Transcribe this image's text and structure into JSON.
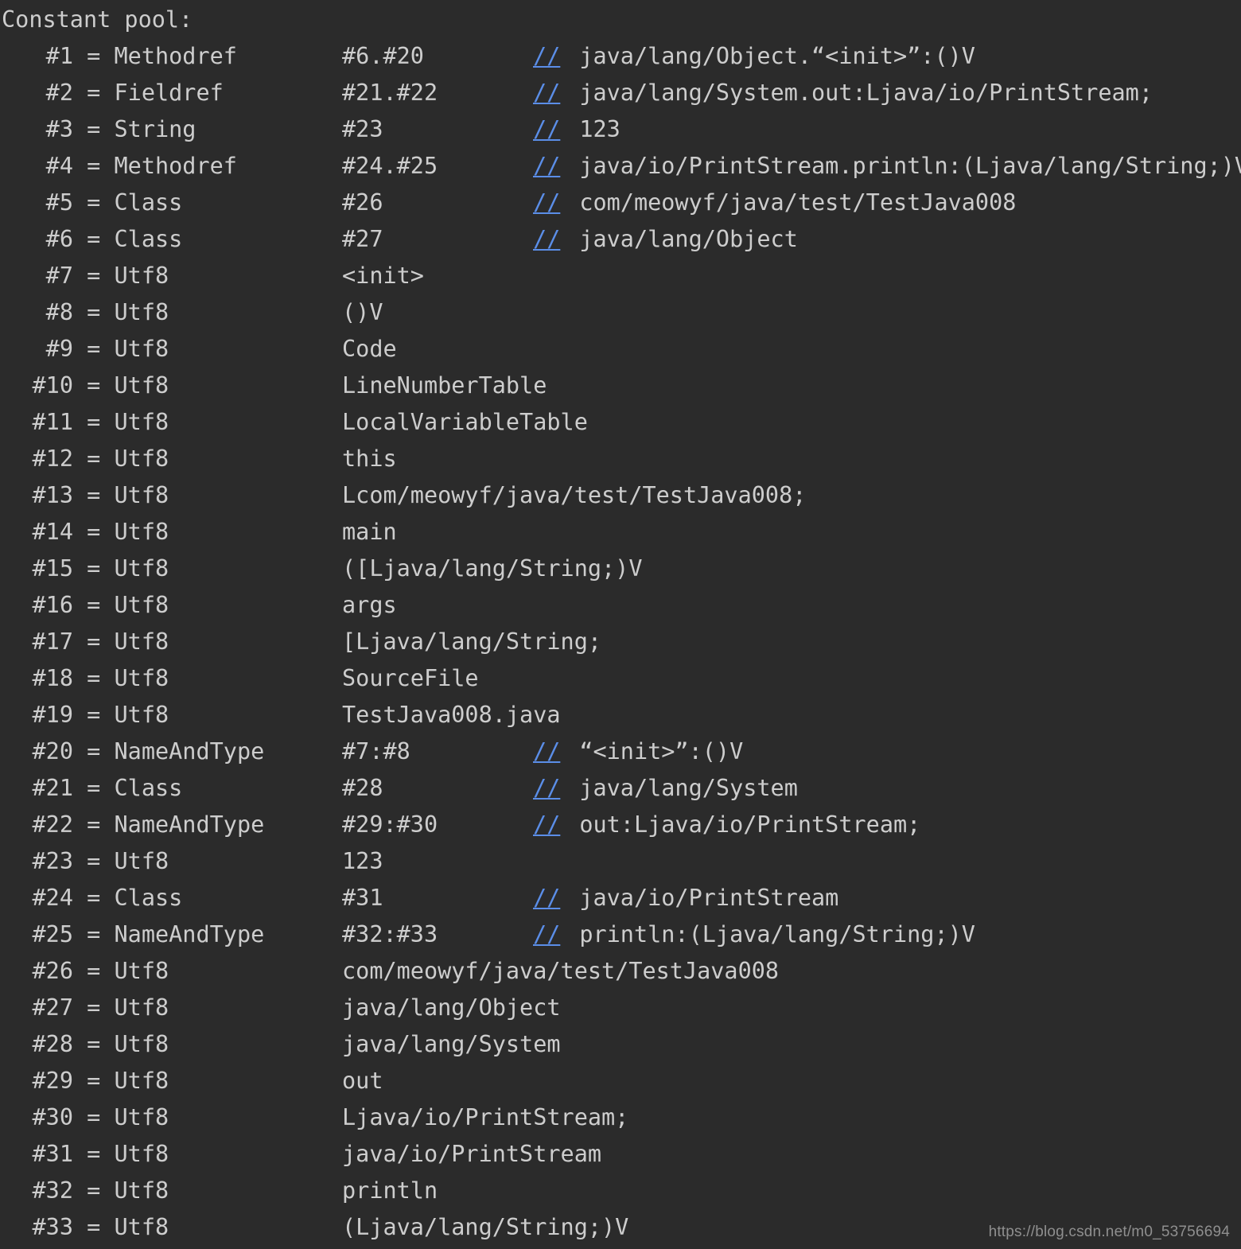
{
  "terminal": {
    "background_color": "#2b2b2b",
    "text_color": "#cdcdcd",
    "link_color": "#5b8ee8",
    "header": "Constant pool:"
  },
  "watermark": {
    "text": "https://blog.csdn.net/m0_53756694"
  },
  "constant_pool": [
    {
      "index": "#1",
      "eq": "=",
      "tag": "Methodref",
      "value": "#6.#20",
      "slashes": "//",
      "comment": "java/lang/Object.“<init>”:()V"
    },
    {
      "index": "#2",
      "eq": "=",
      "tag": "Fieldref",
      "value": "#21.#22",
      "slashes": "//",
      "comment": "java/lang/System.out:Ljava/io/PrintStream;"
    },
    {
      "index": "#3",
      "eq": "=",
      "tag": "String",
      "value": "#23",
      "slashes": "//",
      "comment": "123"
    },
    {
      "index": "#4",
      "eq": "=",
      "tag": "Methodref",
      "value": "#24.#25",
      "slashes": "//",
      "comment": "java/io/PrintStream.println:(Ljava/lang/String;)V"
    },
    {
      "index": "#5",
      "eq": "=",
      "tag": "Class",
      "value": "#26",
      "slashes": "//",
      "comment": "com/meowyf/java/test/TestJava008"
    },
    {
      "index": "#6",
      "eq": "=",
      "tag": "Class",
      "value": "#27",
      "slashes": "//",
      "comment": "java/lang/Object"
    },
    {
      "index": "#7",
      "eq": "=",
      "tag": "Utf8",
      "value": "<init>",
      "slashes": "",
      "comment": ""
    },
    {
      "index": "#8",
      "eq": "=",
      "tag": "Utf8",
      "value": "()V",
      "slashes": "",
      "comment": ""
    },
    {
      "index": "#9",
      "eq": "=",
      "tag": "Utf8",
      "value": "Code",
      "slashes": "",
      "comment": ""
    },
    {
      "index": "#10",
      "eq": "=",
      "tag": "Utf8",
      "value": "LineNumberTable",
      "slashes": "",
      "comment": ""
    },
    {
      "index": "#11",
      "eq": "=",
      "tag": "Utf8",
      "value": "LocalVariableTable",
      "slashes": "",
      "comment": ""
    },
    {
      "index": "#12",
      "eq": "=",
      "tag": "Utf8",
      "value": "this",
      "slashes": "",
      "comment": ""
    },
    {
      "index": "#13",
      "eq": "=",
      "tag": "Utf8",
      "value": "Lcom/meowyf/java/test/TestJava008;",
      "slashes": "",
      "comment": ""
    },
    {
      "index": "#14",
      "eq": "=",
      "tag": "Utf8",
      "value": "main",
      "slashes": "",
      "comment": ""
    },
    {
      "index": "#15",
      "eq": "=",
      "tag": "Utf8",
      "value": "([Ljava/lang/String;)V",
      "slashes": "",
      "comment": ""
    },
    {
      "index": "#16",
      "eq": "=",
      "tag": "Utf8",
      "value": "args",
      "slashes": "",
      "comment": ""
    },
    {
      "index": "#17",
      "eq": "=",
      "tag": "Utf8",
      "value": "[Ljava/lang/String;",
      "slashes": "",
      "comment": ""
    },
    {
      "index": "#18",
      "eq": "=",
      "tag": "Utf8",
      "value": "SourceFile",
      "slashes": "",
      "comment": ""
    },
    {
      "index": "#19",
      "eq": "=",
      "tag": "Utf8",
      "value": "TestJava008.java",
      "slashes": "",
      "comment": ""
    },
    {
      "index": "#20",
      "eq": "=",
      "tag": "NameAndType",
      "value": "#7:#8",
      "slashes": "//",
      "comment": "“<init>”:()V"
    },
    {
      "index": "#21",
      "eq": "=",
      "tag": "Class",
      "value": "#28",
      "slashes": "//",
      "comment": "java/lang/System"
    },
    {
      "index": "#22",
      "eq": "=",
      "tag": "NameAndType",
      "value": "#29:#30",
      "slashes": "//",
      "comment": "out:Ljava/io/PrintStream;"
    },
    {
      "index": "#23",
      "eq": "=",
      "tag": "Utf8",
      "value": "123",
      "slashes": "",
      "comment": ""
    },
    {
      "index": "#24",
      "eq": "=",
      "tag": "Class",
      "value": "#31",
      "slashes": "//",
      "comment": "java/io/PrintStream"
    },
    {
      "index": "#25",
      "eq": "=",
      "tag": "NameAndType",
      "value": "#32:#33",
      "slashes": "//",
      "comment": "println:(Ljava/lang/String;)V"
    },
    {
      "index": "#26",
      "eq": "=",
      "tag": "Utf8",
      "value": "com/meowyf/java/test/TestJava008",
      "slashes": "",
      "comment": ""
    },
    {
      "index": "#27",
      "eq": "=",
      "tag": "Utf8",
      "value": "java/lang/Object",
      "slashes": "",
      "comment": ""
    },
    {
      "index": "#28",
      "eq": "=",
      "tag": "Utf8",
      "value": "java/lang/System",
      "slashes": "",
      "comment": ""
    },
    {
      "index": "#29",
      "eq": "=",
      "tag": "Utf8",
      "value": "out",
      "slashes": "",
      "comment": ""
    },
    {
      "index": "#30",
      "eq": "=",
      "tag": "Utf8",
      "value": "Ljava/io/PrintStream;",
      "slashes": "",
      "comment": ""
    },
    {
      "index": "#31",
      "eq": "=",
      "tag": "Utf8",
      "value": "java/io/PrintStream",
      "slashes": "",
      "comment": ""
    },
    {
      "index": "#32",
      "eq": "=",
      "tag": "Utf8",
      "value": "println",
      "slashes": "",
      "comment": ""
    },
    {
      "index": "#33",
      "eq": "=",
      "tag": "Utf8",
      "value": "(Ljava/lang/String;)V",
      "slashes": "",
      "comment": ""
    }
  ]
}
